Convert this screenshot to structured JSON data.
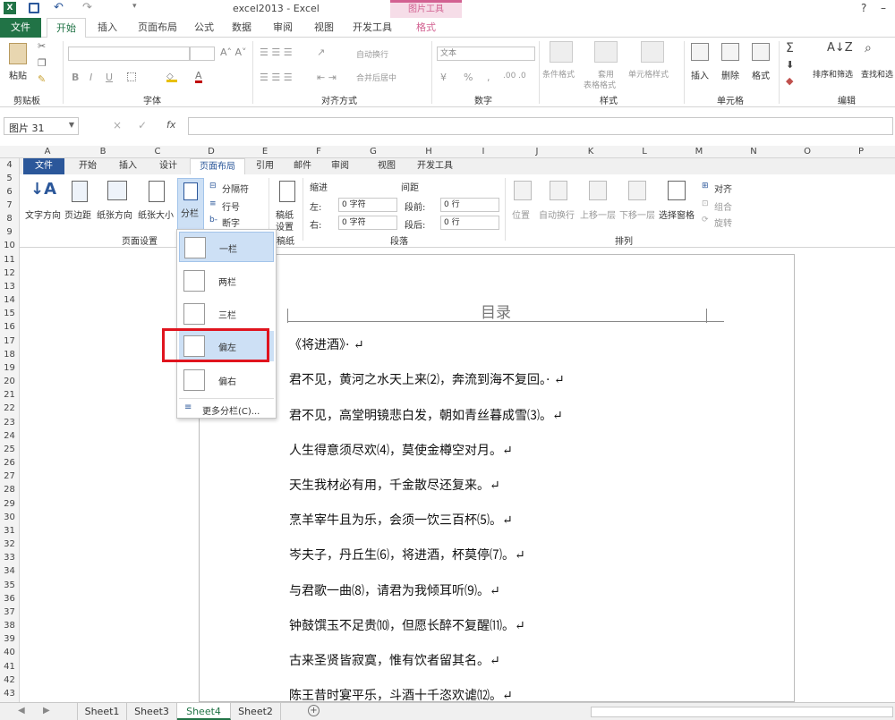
{
  "title_bar": {
    "title": "excel2013 - Excel",
    "context_tab": "图片工具",
    "help": "?"
  },
  "excel_tabs": [
    {
      "label": "文件",
      "active": false
    },
    {
      "label": "开始",
      "active": true
    },
    {
      "label": "插入"
    },
    {
      "label": "页面布局"
    },
    {
      "label": "公式"
    },
    {
      "label": "数据"
    },
    {
      "label": "审阅"
    },
    {
      "label": "视图"
    },
    {
      "label": "开发工具"
    },
    {
      "label": "格式"
    }
  ],
  "excel_ribbon": {
    "paste": "粘贴",
    "clipboard": "剪贴板",
    "font": "字体",
    "alignment": "对齐方式",
    "wrap": "自动换行",
    "merge": "合并后居中",
    "number_format": "文本",
    "number": "数字",
    "cond_format": "条件格式",
    "table_format_1": "套用",
    "table_format_2": "表格格式",
    "cell_style": "单元格样式",
    "styles": "样式",
    "insert": "插入",
    "delete": "删除",
    "format": "格式",
    "cells": "单元格",
    "sort": "排序和筛选",
    "find": "查找和选",
    "editing": "编辑",
    "bold": "B",
    "italic": "I",
    "underline": "U",
    "percent": "%",
    "comma": ","
  },
  "formula_bar": {
    "name_box": "图片 31",
    "fx": "fx",
    "cancel": "×",
    "enter": "✓"
  },
  "columns": [
    "A",
    "B",
    "C",
    "D",
    "E",
    "F",
    "G",
    "H",
    "I",
    "J",
    "K",
    "L",
    "M",
    "N",
    "O",
    "P"
  ],
  "rows": [
    "4",
    "5",
    "6",
    "7",
    "8",
    "9",
    "10",
    "11",
    "12",
    "13",
    "14",
    "15",
    "16",
    "17",
    "18",
    "19",
    "20",
    "21",
    "22",
    "23",
    "24",
    "25",
    "26",
    "27",
    "28",
    "29",
    "30",
    "31",
    "32",
    "33",
    "34",
    "35",
    "36",
    "37",
    "38",
    "39",
    "40",
    "41",
    "42",
    "43"
  ],
  "word_tabs": [
    {
      "label": "文件"
    },
    {
      "label": "开始"
    },
    {
      "label": "插入"
    },
    {
      "label": "设计"
    },
    {
      "label": "页面布局",
      "active": true
    },
    {
      "label": "引用"
    },
    {
      "label": "邮件"
    },
    {
      "label": "审阅"
    },
    {
      "label": "视图"
    },
    {
      "label": "开发工具"
    }
  ],
  "word_ribbon": {
    "text_dir": "文字方向",
    "margins": "页边距",
    "orientation": "纸张方向",
    "size": "纸张大小",
    "columns": "分栏",
    "breaks": "分隔符",
    "line_numbers": "行号",
    "hyphenation": "断字",
    "page_setup": "页面设置",
    "draft_1": "稿纸",
    "draft_2": "设置",
    "draft_group": "稿纸",
    "indent": "缩进",
    "spacing": "间距",
    "left": "左:",
    "right": "右:",
    "before": "段前:",
    "after": "段后:",
    "left_val": "0 字符",
    "right_val": "0 字符",
    "before_val": "0 行",
    "after_val": "0 行",
    "paragraph": "段落",
    "position": "位置",
    "wrap_text": "自动换行",
    "bring_fwd": "上移一层",
    "send_back": "下移一层",
    "sel_pane": "选择窗格",
    "align": "对齐",
    "group": "组合",
    "rotate": "旋转",
    "arrange": "排列"
  },
  "columns_menu": {
    "items": [
      {
        "label": "一栏"
      },
      {
        "label": "两栏"
      },
      {
        "label": "三栏"
      },
      {
        "label": "偏左",
        "highlighted": true
      },
      {
        "label": "偏右"
      }
    ],
    "more": "更多分栏(C)..."
  },
  "document": {
    "heading": "目录",
    "lines": [
      "《将进酒》· ↵",
      "君不见，黄河之水天上来⑵，奔流到海不复回。· ↵",
      "君不见，高堂明镜悲白发，朝如青丝暮成雪⑶。↵",
      "人生得意须尽欢⑷，莫使金樽空对月。↵",
      "天生我材必有用，千金散尽还复来。↵",
      "烹羊宰牛且为乐，会须一饮三百杯⑸。↵",
      "岑夫子，丹丘生⑹，将进酒，杯莫停⑺。↵",
      "与君歌一曲⑻，请君为我倾耳听⑼。↵",
      "钟鼓馔玉不足贵⑽，但愿长醉不复醒⑾。↵",
      "古来圣贤皆寂寞，惟有饮者留其名。↵",
      "陈王昔时宴平乐，斗酒十千恣欢谑⑿。↵"
    ]
  },
  "sheet_tabs": [
    {
      "label": "Sheet1"
    },
    {
      "label": "Sheet3"
    },
    {
      "label": "Sheet4",
      "active": true
    },
    {
      "label": "Sheet2"
    }
  ],
  "colors": {
    "excel_green": "#217346",
    "word_blue": "#2b579a",
    "highlight_red": "#e0141e",
    "context_pink": "#d26191"
  }
}
